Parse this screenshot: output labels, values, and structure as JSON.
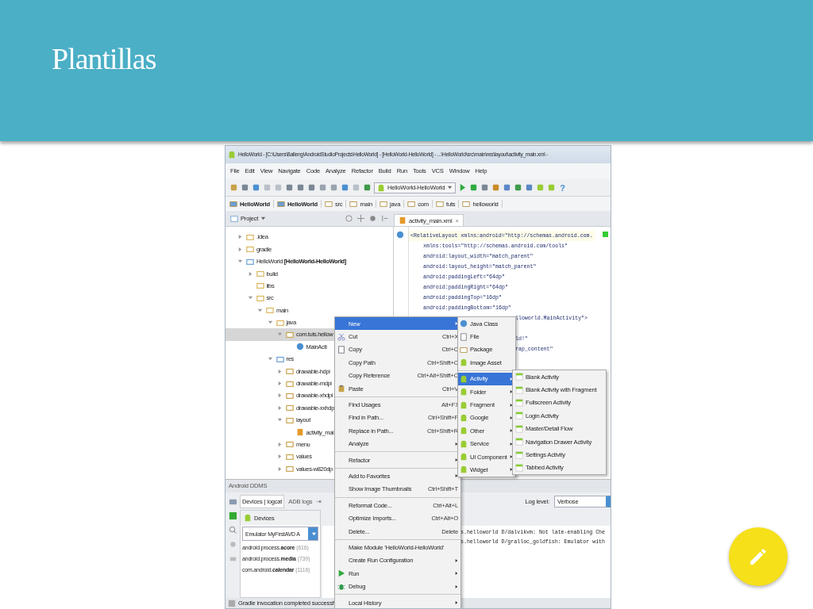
{
  "slide": {
    "title": "Plantillas"
  },
  "window": {
    "title": "HelloWorld - [C:\\Users\\Balleng\\AndroidStudioProjects\\HelloWorld] - [HelloWorld-HelloWorld] - ...\\HelloWorld\\src\\main\\res\\layout\\activity_main.xml -"
  },
  "menu_bar": [
    "File",
    "Edit",
    "View",
    "Navigate",
    "Code",
    "Analyze",
    "Refactor",
    "Build",
    "Run",
    "Tools",
    "VCS",
    "Window",
    "Help"
  ],
  "toolbar": {
    "run_configuration": "HelloWorld-HelloWorld",
    "help": "?"
  },
  "breadcrumbs": [
    {
      "label": "HelloWorld",
      "kind": "module"
    },
    {
      "label": "HelloWorld",
      "kind": "module"
    },
    {
      "label": "src",
      "kind": "folder"
    },
    {
      "label": "main",
      "kind": "folder"
    },
    {
      "label": "java",
      "kind": "folder"
    },
    {
      "label": "com",
      "kind": "folder"
    },
    {
      "label": "tuts",
      "kind": "folder"
    },
    {
      "label": "helloworld",
      "kind": "folder"
    }
  ],
  "project_panel": {
    "view": "Project"
  },
  "project_tree": [
    {
      "label": ".idea",
      "kind": "folder",
      "expanded": false
    },
    {
      "label": "gradle",
      "kind": "folder",
      "expanded": false
    },
    {
      "label": "HelloWorld **[HelloWorld-HelloWorld]**",
      "kind": "module",
      "expanded": true,
      "children": [
        {
          "label": "build",
          "kind": "folder",
          "expanded": false
        },
        {
          "label": "libs",
          "kind": "folder"
        },
        {
          "label": "src",
          "kind": "folder",
          "expanded": true,
          "children": [
            {
              "label": "main",
              "kind": "folder",
              "expanded": true,
              "children": [
                {
                  "label": "java",
                  "kind": "folder",
                  "expanded": true,
                  "children": [
                    {
                      "label": "com.tuts.hellow",
                      "kind": "package",
                      "expanded": true,
                      "selected": true,
                      "children": [
                        {
                          "label": "MainActi",
                          "kind": "class"
                        }
                      ]
                    }
                  ]
                },
                {
                  "label": "res",
                  "kind": "module",
                  "expanded": true,
                  "children": [
                    {
                      "label": "drawable-hdpi",
                      "kind": "package",
                      "expanded": false
                    },
                    {
                      "label": "drawable-mdpi",
                      "kind": "package",
                      "expanded": false
                    },
                    {
                      "label": "drawable-xhdpi",
                      "kind": "package",
                      "expanded": false
                    },
                    {
                      "label": "drawable-xxhdpi",
                      "kind": "package",
                      "expanded": false
                    },
                    {
                      "label": "layout",
                      "kind": "package",
                      "expanded": true,
                      "children": [
                        {
                          "label": "activity_mai",
                          "kind": "layout"
                        }
                      ]
                    },
                    {
                      "label": "menu",
                      "kind": "package",
                      "expanded": false
                    },
                    {
                      "label": "values",
                      "kind": "package",
                      "expanded": false
                    },
                    {
                      "label": "values-w820dp",
                      "kind": "package",
                      "expanded": false
                    }
                  ]
                }
              ]
            }
          ]
        }
      ]
    }
  ],
  "editor": {
    "tab": "activity_main.xml",
    "close": "×",
    "lines": [
      "<RelativeLayout xmlns:android=\"http://schemas.android.com.",
      "xmlns:tools=\"http://schemas.android.com/tools\"",
      "android:layout_width=\"match_parent\"",
      "android:layout_height=\"match_parent\"",
      "android:paddingLeft=\"64dp\"",
      "android:paddingRight=\"64dp\"",
      "android:paddingTop=\"16dp\"",
      "android:paddingBottom=\"16dp\""
    ],
    "partial_lines": [
      "lloworld.MainActivity\">",
      "ld!\"",
      "rap_content\""
    ]
  },
  "ddms": {
    "title": "Android DDMS",
    "tabs": [
      {
        "label": "Devices | logcat",
        "selected": true
      },
      {
        "label": "ADB logs",
        "selected": false
      }
    ],
    "pin": "⇥",
    "log_level_label": "Log level:",
    "log_level": "Verbose",
    "devices_title": "Devices",
    "device": "Emulator MyFirstAVD A",
    "processes": [
      {
        "name": "android.process.**acore**",
        "pid": "(616)"
      },
      {
        "name": "android.process.**media**",
        "pid": "(739)"
      },
      {
        "name": "com.android.**calendar**",
        "pid": "(1116)"
      }
    ],
    "log_lines": [
      "s.helloworld D/dalvikvm:  Not late-enabling Che",
      "s.helloworld D/gralloc_goldfish:  Emulator with"
    ]
  },
  "status_bar": "Gradle invocation completed successf",
  "context_menu": [
    [
      {
        "label": "New",
        "submenu": true,
        "selected": true
      },
      {
        "label": "Cut",
        "shortcut": "Ctrl+X",
        "kind": "cut",
        "selected": false
      },
      {
        "label": "Copy",
        "shortcut": "Ctrl+C",
        "kind": "copy",
        "selected": false
      },
      {
        "label": "Copy Path",
        "shortcut": "Ctrl+Shift+C",
        "selected": false
      },
      {
        "label": "Copy Reference",
        "shortcut": "Ctrl+Alt+Shift+C",
        "selected": false
      },
      {
        "label": "Paste",
        "shortcut": "Ctrl+V",
        "kind": "paste",
        "selected": false
      }
    ],
    [
      {
        "label": "Find Usages",
        "shortcut": "Alt+F7",
        "selected": false
      },
      {
        "label": "Find in Path...",
        "shortcut": "Ctrl+Shift+F",
        "selected": false
      },
      {
        "label": "Replace in Path...",
        "shortcut": "Ctrl+Shift+R",
        "selected": false
      },
      {
        "label": "Analyze",
        "submenu": true,
        "selected": false
      }
    ],
    [
      {
        "label": "Refactor",
        "submenu": true,
        "selected": false
      }
    ],
    [
      {
        "label": "Add to Favorites",
        "submenu": true,
        "selected": false
      },
      {
        "label": "Show Image Thumbnails",
        "shortcut": "Ctrl+Shift+T",
        "selected": false
      }
    ],
    [
      {
        "label": "Reformat Code...",
        "shortcut": "Ctrl+Alt+L",
        "selected": false
      },
      {
        "label": "Optimize Imports...",
        "shortcut": "Ctrl+Alt+O",
        "selected": false
      },
      {
        "label": "Delete...",
        "shortcut": "Delete",
        "selected": false
      }
    ],
    [
      {
        "label": "Make Module 'HelloWorld-HelloWorld'",
        "selected": false
      },
      {
        "label": "Create Run Configuration",
        "submenu": true,
        "selected": false
      },
      {
        "label": "Run",
        "submenu": true,
        "kind": "run",
        "selected": false
      },
      {
        "label": "Debug",
        "submenu": true,
        "kind": "debug",
        "selected": false
      }
    ],
    [
      {
        "label": "Local History",
        "submenu": true,
        "selected": false
      }
    ]
  ],
  "new_submenu": [
    [
      {
        "label": "Java Class",
        "kind": "class",
        "selected": false
      },
      {
        "label": "File",
        "kind": "file",
        "selected": false
      },
      {
        "label": "Package",
        "kind": "package",
        "selected": false
      },
      {
        "label": "Image Asset",
        "kind": "android",
        "selected": false
      }
    ],
    [
      {
        "label": "Activity",
        "kind": "android",
        "submenu": true,
        "selected": true
      },
      {
        "label": "Folder",
        "kind": "android",
        "submenu": true,
        "selected": false
      },
      {
        "label": "Fragment",
        "kind": "android",
        "submenu": true,
        "selected": false
      },
      {
        "label": "Google",
        "kind": "android",
        "submenu": true,
        "selected": false
      },
      {
        "label": "Other",
        "kind": "android",
        "submenu": true,
        "selected": false
      },
      {
        "label": "Service",
        "kind": "android",
        "submenu": true,
        "selected": false
      },
      {
        "label": "UI Component",
        "kind": "android",
        "submenu": true,
        "selected": false
      },
      {
        "label": "Widget",
        "kind": "android",
        "submenu": true,
        "selected": false
      }
    ]
  ],
  "activity_submenu": [
    {
      "label": "Blank Activity",
      "selected": false
    },
    {
      "label": "Blank Activity with Fragment",
      "selected": false
    },
    {
      "label": "Fullscreen Activity",
      "selected": false
    },
    {
      "label": "Login Activity",
      "selected": false
    },
    {
      "label": "Master/Detail Flow",
      "selected": false
    },
    {
      "label": "Navigation Drawer Activity",
      "selected": false
    },
    {
      "label": "Settings Activity",
      "selected": false
    },
    {
      "label": "Tabbed Activity",
      "selected": false
    }
  ]
}
